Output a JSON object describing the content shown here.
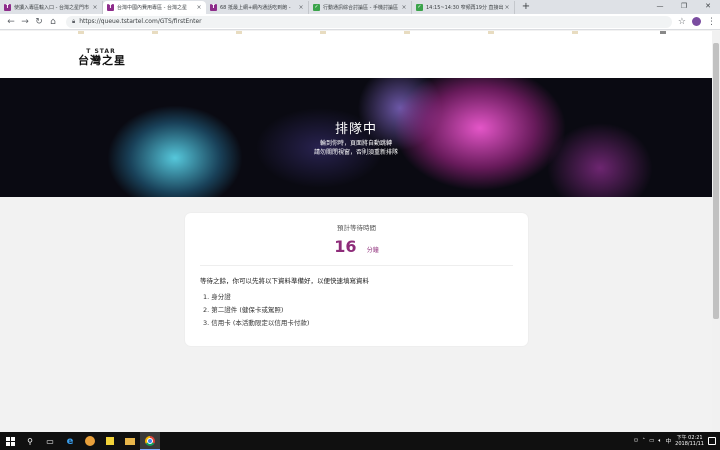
{
  "browser": {
    "tabs": [
      {
        "title": "使讀入專區輸入口 - 台灣之星門市",
        "favicon": "T",
        "active": false,
        "color": "#8e2c8b"
      },
      {
        "title": "台灣中國內費用專區 - 台灣之星",
        "favicon": "T",
        "active": true,
        "color": "#8e2c8b"
      },
      {
        "title": "68 抵最上網+網內通話吃到飽 -",
        "favicon": "T",
        "active": false,
        "color": "#8e2c8b"
      },
      {
        "title": "行動通訊綜合討論區 - 手機討論區",
        "favicon": "✓",
        "active": false,
        "color": "#3aa34a"
      },
      {
        "title": "14:15~14:30 窄頻再19分 直接出",
        "favicon": "✓",
        "active": false,
        "color": "#3aa34a"
      }
    ],
    "new_tab": "+",
    "url": "https://queue.tstartel.com/GTS/firstEnter"
  },
  "site": {
    "logo_top": "T STAR",
    "logo_name": "台灣之星"
  },
  "hero": {
    "title": "排隊中",
    "line1": "輪到你時，頁面將自動跳轉",
    "line2": "請勿關閉視窗，否則須重新排隊"
  },
  "card": {
    "wait_label": "預計等待時間",
    "wait_minutes": "16",
    "wait_unit": "分鐘",
    "instruction": "等待之餘，你可以先將以下資料準備好，以便快速填寫資料",
    "items": [
      "1.  身分證",
      "2.  第二證件 (健保卡或駕照)",
      "3.  信用卡 (本活動限定以信用卡付款)"
    ]
  },
  "taskbar": {
    "clock_time": "下午 02:21",
    "clock_date": "2018/11/11"
  },
  "colors": {
    "brand": "#8e2c7a",
    "taskbar": "#101010"
  }
}
